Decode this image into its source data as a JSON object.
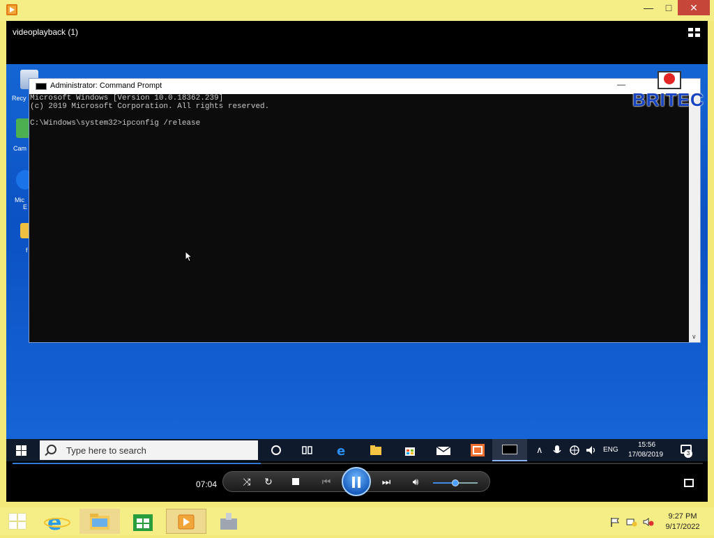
{
  "window": {
    "title_icon": "media-player-icon",
    "controls": {
      "minimize": "—",
      "maximize": "□",
      "close": "✕"
    }
  },
  "player": {
    "title": "videoplayback (1)",
    "time": "07:04",
    "progress_fraction": 0.36,
    "volume_fraction": 0.5
  },
  "video": {
    "desktop_icons": [
      {
        "label": "Recy"
      },
      {
        "label": "Cam"
      },
      {
        "label": "Mic"
      },
      {
        "label": "E"
      },
      {
        "label": "f"
      }
    ],
    "cmd": {
      "title": "Administrator: Command Prompt",
      "lines": [
        "Microsoft Windows [Version 10.0.18362.239]",
        "(c) 2019 Microsoft Corporation. All rights reserved.",
        "",
        "C:\\Windows\\system32>ipconfig /release"
      ]
    },
    "watermark": {
      "brand": "BRITEC"
    },
    "taskbar": {
      "search_placeholder": "Type here to search",
      "language": "ENG",
      "time": "15:56",
      "date": "17/08/2019",
      "notifications": "3"
    }
  },
  "w8_taskbar": {
    "time": "9:27 PM",
    "date": "9/17/2022"
  }
}
